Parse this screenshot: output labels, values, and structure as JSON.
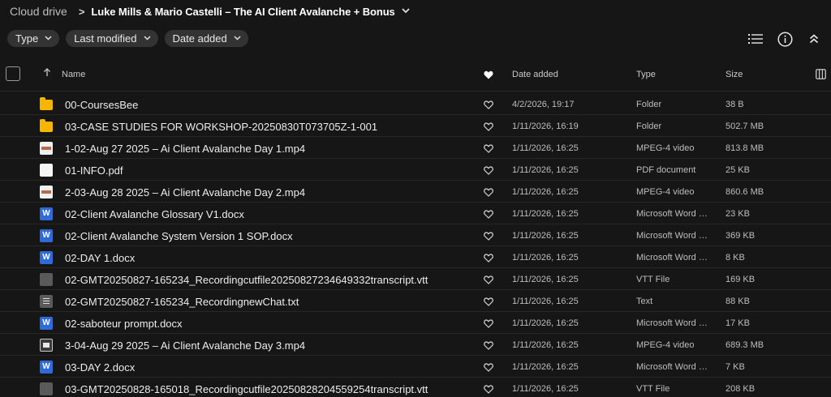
{
  "breadcrumb": {
    "root": "Cloud drive",
    "separator": ">",
    "current": "Luke Mills & Mario Castelli – The AI Client Avalanche + Bonus"
  },
  "filters": [
    {
      "label": "Type"
    },
    {
      "label": "Last modified"
    },
    {
      "label": "Date added"
    }
  ],
  "toolbar": {
    "list_view_icon": "list-view-icon",
    "info_icon": "info-icon",
    "collapse_icon": "collapse-up-icon"
  },
  "columns": {
    "name": "Name",
    "date_added": "Date added",
    "type": "Type",
    "size": "Size"
  },
  "colors": {
    "background": "#161616",
    "folder": "#f7b500",
    "word": "#2f6bd8",
    "chip": "#333333"
  },
  "rows": [
    {
      "icon": "folder",
      "name": "00-CoursesBee",
      "date": "4/2/2026, 19:17",
      "type": "Folder",
      "size": "38 B"
    },
    {
      "icon": "folder",
      "name": "03-CASE STUDIES FOR WORKSHOP-20250830T073705Z-1-001",
      "date": "1/11/2026, 16:19",
      "type": "Folder",
      "size": "502.7 MB"
    },
    {
      "icon": "video",
      "name": "1-02-Aug 27 2025 – Ai Client Avalanche Day 1.mp4",
      "date": "1/11/2026, 16:25",
      "type": "MPEG-4 video",
      "size": "813.8 MB"
    },
    {
      "icon": "pdf",
      "name": "01-INFO.pdf",
      "date": "1/11/2026, 16:25",
      "type": "PDF document",
      "size": "25 KB"
    },
    {
      "icon": "video",
      "name": "2-03-Aug 28 2025 – Ai Client Avalanche Day 2.mp4",
      "date": "1/11/2026, 16:25",
      "type": "MPEG-4 video",
      "size": "860.6 MB"
    },
    {
      "icon": "word",
      "name": "02-Client Avalanche Glossary V1.docx",
      "date": "1/11/2026, 16:25",
      "type": "Microsoft Word d...",
      "size": "23 KB"
    },
    {
      "icon": "word",
      "name": "02-Client Avalanche System Version 1 SOP.docx",
      "date": "1/11/2026, 16:25",
      "type": "Microsoft Word d...",
      "size": "369 KB"
    },
    {
      "icon": "word",
      "name": "02-DAY 1.docx",
      "date": "1/11/2026, 16:25",
      "type": "Microsoft Word d...",
      "size": "8 KB"
    },
    {
      "icon": "vtt",
      "name": "02-GMT20250827-165234_Recordingcutfile20250827234649332transcript.vtt",
      "date": "1/11/2026, 16:25",
      "type": "VTT File",
      "size": "169 KB"
    },
    {
      "icon": "txt",
      "name": "02-GMT20250827-165234_RecordingnewChat.txt",
      "date": "1/11/2026, 16:25",
      "type": "Text",
      "size": "88 KB"
    },
    {
      "icon": "word",
      "name": "02-saboteur prompt.docx",
      "date": "1/11/2026, 16:25",
      "type": "Microsoft Word d...",
      "size": "17 KB"
    },
    {
      "icon": "video-dark",
      "name": "3-04-Aug 29 2025 – Ai Client Avalanche Day 3.mp4",
      "date": "1/11/2026, 16:25",
      "type": "MPEG-4 video",
      "size": "689.3 MB"
    },
    {
      "icon": "word",
      "name": "03-DAY 2.docx",
      "date": "1/11/2026, 16:25",
      "type": "Microsoft Word d...",
      "size": "7 KB"
    },
    {
      "icon": "vtt",
      "name": "03-GMT20250828-165018_Recordingcutfile20250828204559254transcript.vtt",
      "date": "1/11/2026, 16:25",
      "type": "VTT File",
      "size": "208 KB"
    }
  ]
}
